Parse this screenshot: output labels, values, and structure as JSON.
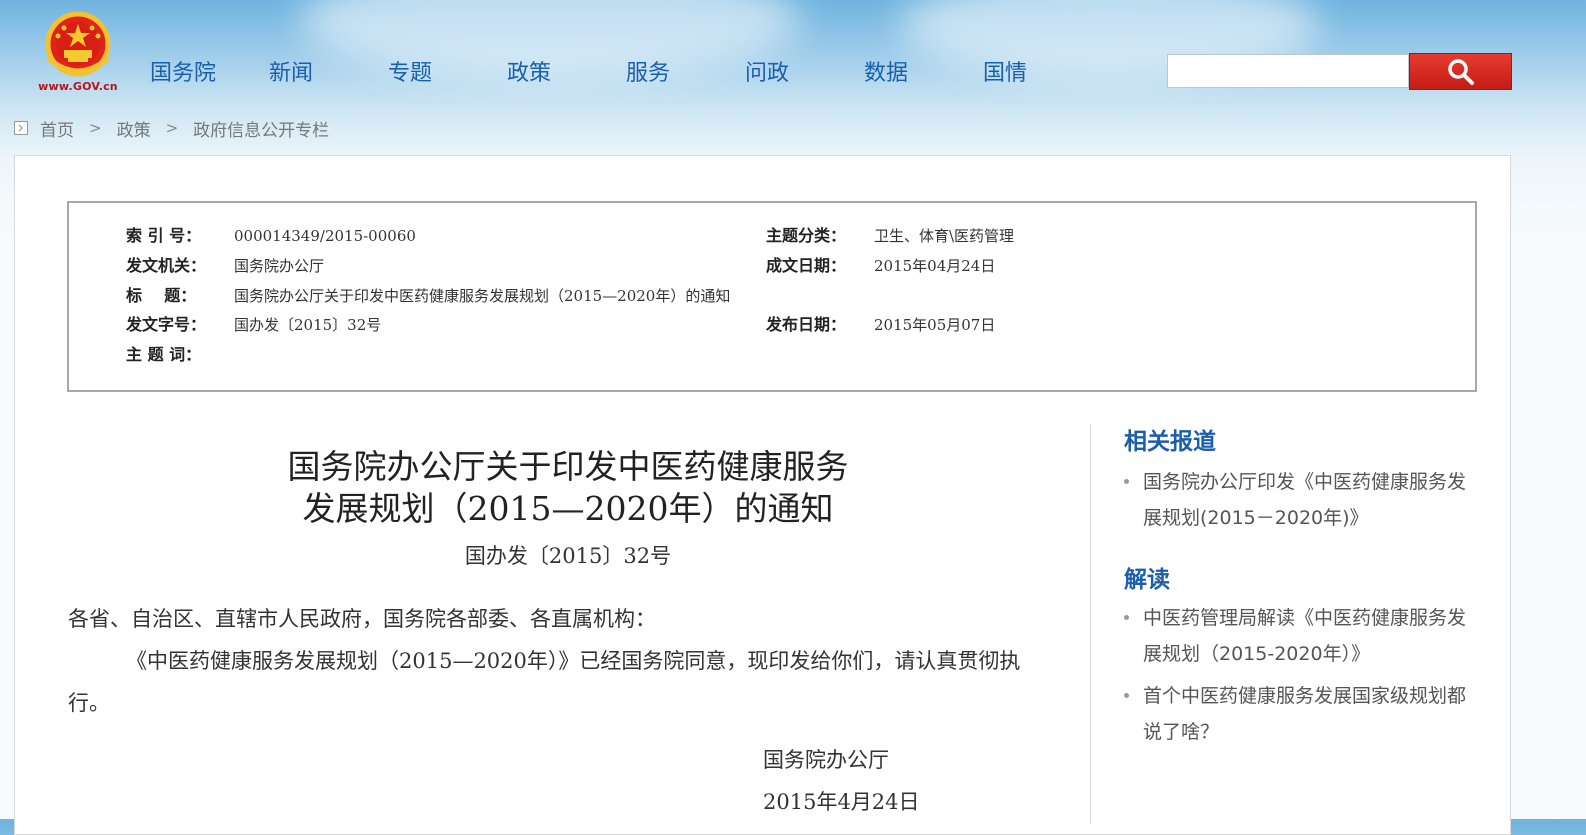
{
  "header": {
    "logo_text": "www.GOV.cn",
    "nav": [
      "国务院",
      "新闻",
      "专题",
      "政策",
      "服务",
      "问政",
      "数据",
      "国情"
    ],
    "search_placeholder": "",
    "search_icon": "magnifier-icon",
    "accent_color": "#c41d16",
    "nav_color": "#1b5fab"
  },
  "breadcrumb": {
    "items": [
      "首页",
      "政策",
      "政府信息公开专栏"
    ],
    "separator": ">"
  },
  "info": {
    "index_label": "索 引 号：",
    "index_value": "000014349/2015-00060",
    "category_label": "主题分类：",
    "category_value": "卫生、体育\\医药管理",
    "issuer_label": "发文机关：",
    "issuer_value": "国务院办公厅",
    "date_written_label": "成文日期：",
    "date_written_value": "2015年04月24日",
    "title_label": "标    题：",
    "title_value": "国务院办公厅关于印发中医药健康服务发展规划（2015—2020年）的通知",
    "doc_no_label": "发文字号：",
    "doc_no_value": "国办发〔2015〕32号",
    "pub_date_label": "发布日期：",
    "pub_date_value": "2015年05月07日",
    "keywords_label": "主 题 词：",
    "keywords_value": ""
  },
  "article": {
    "title_line1": "国务院办公厅关于印发中医药健康服务",
    "title_line2": "发展规划（2015—2020年）的通知",
    "doc_number": "国办发〔2015〕32号",
    "salutation": "各省、自治区、直辖市人民政府，国务院各部委、各直属机构：",
    "paragraph": "《中医药健康服务发展规划（2015—2020年）》已经国务院同意，现印发给你们，请认真贯彻执行。",
    "signer": "国务院办公厅",
    "sign_date": "2015年4月24日"
  },
  "sidebar": {
    "related_heading": "相关报道",
    "related": [
      "国务院办公厅印发《中医药健康服务发展规划(2015－2020年)》"
    ],
    "interpret_heading": "解读",
    "interpret": [
      "中医药管理局解读《中医药健康服务发展规划（2015-2020年）》",
      "首个中医药健康服务发展国家级规划都说了啥？"
    ]
  }
}
